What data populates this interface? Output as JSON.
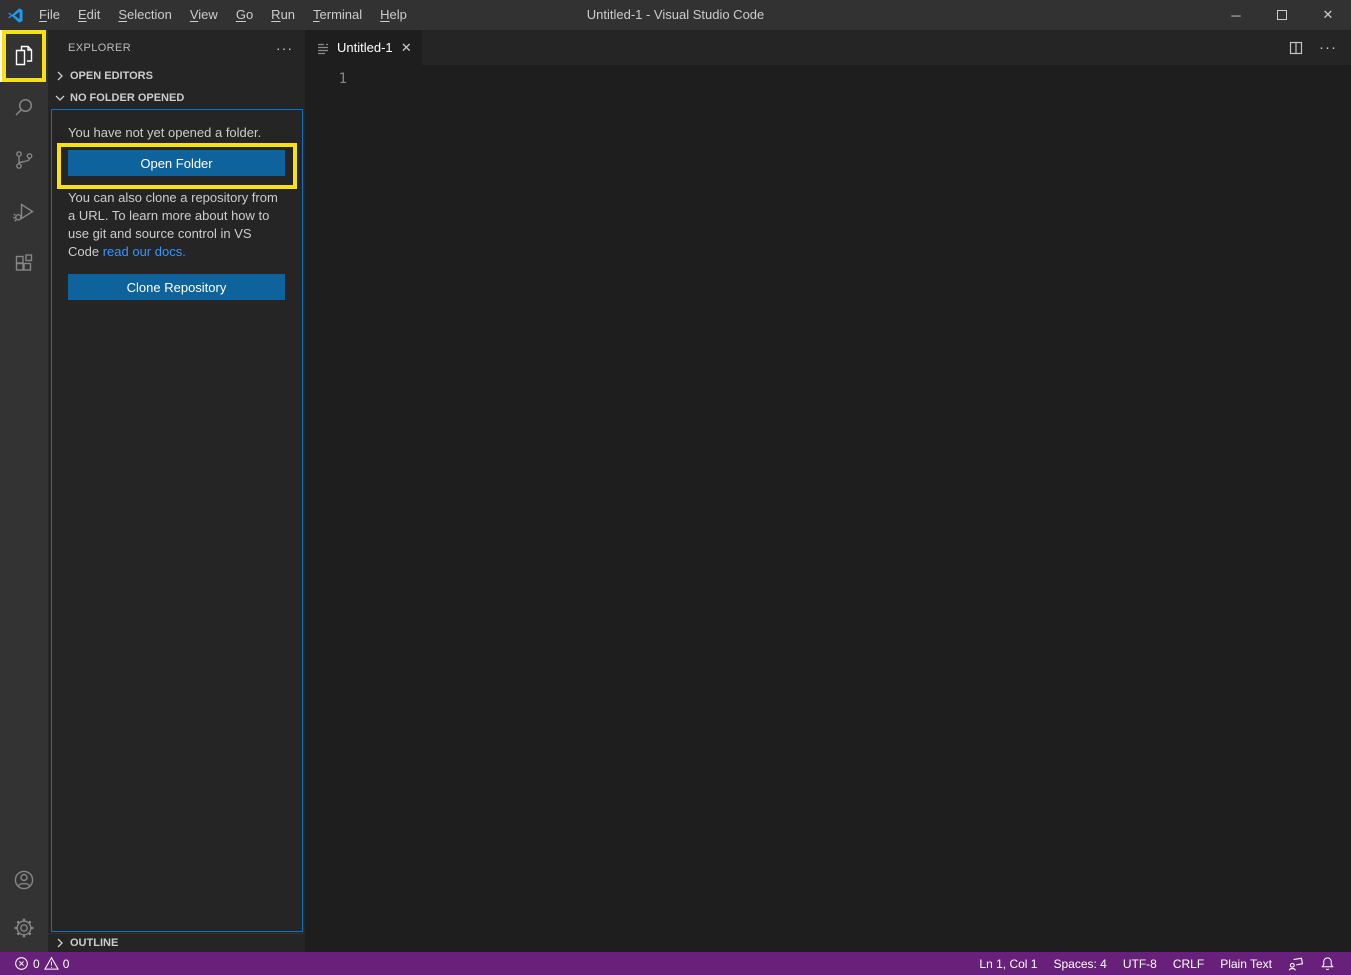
{
  "window": {
    "title": "Untitled-1 - Visual Studio Code",
    "menus": [
      "File",
      "Edit",
      "Selection",
      "View",
      "Go",
      "Run",
      "Terminal",
      "Help"
    ]
  },
  "activity_bar": {
    "items": [
      "Explorer",
      "Search",
      "Source Control",
      "Run and Debug",
      "Extensions"
    ],
    "bottom_items": [
      "Accounts",
      "Manage"
    ]
  },
  "sidebar": {
    "title": "EXPLORER",
    "more_actions": "···",
    "open_editors_label": "OPEN EDITORS",
    "no_folder_label": "NO FOLDER OPENED",
    "no_folder_message": "You have not yet opened a folder.",
    "open_folder_button": "Open Folder",
    "clone_text": "You can also clone a repository from a URL. To learn more about how to use git and source control in VS Code",
    "clone_link": "read our docs.",
    "clone_repo_button": "Clone Repository",
    "outline_label": "OUTLINE"
  },
  "editor": {
    "tab_label": "Untitled-1",
    "tab_close": "✕",
    "more_actions": "···",
    "line_number": "1"
  },
  "status_bar": {
    "errors": "0",
    "warnings": "0",
    "cursor_position": "Ln 1, Col 1",
    "indentation": "Spaces: 4",
    "encoding": "UTF-8",
    "eol": "CRLF",
    "language": "Plain Text"
  },
  "window_controls": {
    "minimize": "─",
    "close": "✕"
  },
  "colors": {
    "status_bar": "#68217A",
    "button": "#0E639C",
    "link": "#3794FF",
    "focus_border": "#0D72C5",
    "annotation_highlight": "#F8E112",
    "titlebar": "#323233",
    "activity_bar": "#333333",
    "sidebar": "#252526",
    "editor": "#1E1E1E",
    "logo_blue": "#1F9CF0"
  },
  "icons": {
    "logo": "vscode-logo",
    "explorer": "files",
    "search": "magnifier",
    "source_control": "git-branch",
    "run_debug": "play-with-bug",
    "extensions": "squares",
    "accounts": "person-circle",
    "manage": "gear",
    "chevron_right": "›",
    "chevron_down": "⌄",
    "tab_file": "text-lines",
    "split_editor": "split-square",
    "errors": "circle-x",
    "warnings": "triangle-exclamation",
    "feedback": "person-bubble",
    "notifications": "bell"
  }
}
